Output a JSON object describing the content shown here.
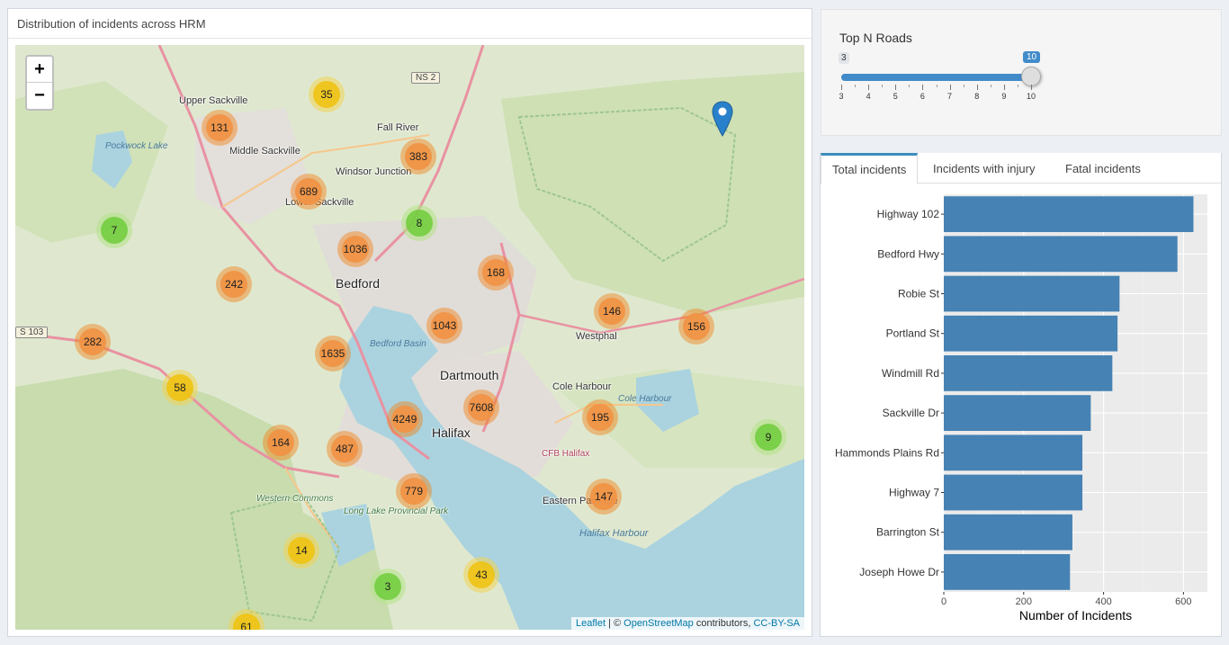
{
  "map_panel": {
    "title": "Distribution of incidents across HRM",
    "zoom_in": "+",
    "zoom_out": "−",
    "attribution": {
      "leaflet": "Leaflet",
      "sep": " | © ",
      "osm": "OpenStreetMap",
      "contrib": " contributors, ",
      "license": "CC-BY-SA"
    },
    "clusters": [
      {
        "label": "35",
        "size": "medium"
      },
      {
        "label": "131",
        "size": "large"
      },
      {
        "label": "383",
        "size": "large"
      },
      {
        "label": "689",
        "size": "large"
      },
      {
        "label": "8",
        "size": "small"
      },
      {
        "label": "7",
        "size": "small"
      },
      {
        "label": "1036",
        "size": "large"
      },
      {
        "label": "168",
        "size": "large"
      },
      {
        "label": "242",
        "size": "large"
      },
      {
        "label": "146",
        "size": "large"
      },
      {
        "label": "156",
        "size": "large"
      },
      {
        "label": "1043",
        "size": "large"
      },
      {
        "label": "282",
        "size": "large"
      },
      {
        "label": "1635",
        "size": "large"
      },
      {
        "label": "58",
        "size": "medium"
      },
      {
        "label": "7608",
        "size": "large"
      },
      {
        "label": "4249",
        "size": "large"
      },
      {
        "label": "195",
        "size": "large"
      },
      {
        "label": "9",
        "size": "small"
      },
      {
        "label": "164",
        "size": "large"
      },
      {
        "label": "487",
        "size": "large"
      },
      {
        "label": "779",
        "size": "large"
      },
      {
        "label": "147",
        "size": "large"
      },
      {
        "label": "14",
        "size": "medium"
      },
      {
        "label": "43",
        "size": "medium"
      },
      {
        "label": "3",
        "size": "small"
      },
      {
        "label": "61",
        "size": "medium"
      }
    ],
    "places": [
      "Upper Sackville",
      "Middle Sackville",
      "Fall River",
      "Windsor Junction",
      "Lower Sackville",
      "Bedford",
      "Dartmouth",
      "Halifax",
      "Westphal",
      "Cole Harbour",
      "CFB Halifax",
      "Eastern Passage"
    ],
    "water": [
      "Pockwock Lake",
      "Bedford Basin",
      "Cole Harbour",
      "Halifax Harbour"
    ],
    "parks": [
      "Western Commons",
      "Long Lake Provincial Park"
    ],
    "shields": [
      "NS 2",
      "S 103"
    ]
  },
  "slider": {
    "label": "Top N Roads",
    "min": 3,
    "max": 10,
    "value": 10,
    "min_label": "3",
    "value_label": "10",
    "tick_labels": [
      "3",
      "4",
      "5",
      "6",
      "7",
      "8",
      "9",
      "10"
    ]
  },
  "tabs": [
    {
      "label": "Total incidents",
      "active": true
    },
    {
      "label": "Incidents with injury",
      "active": false
    },
    {
      "label": "Fatal incidents",
      "active": false
    }
  ],
  "chart_data": {
    "type": "bar",
    "orientation": "horizontal",
    "categories": [
      "Highway 102",
      "Bedford Hwy",
      "Robie St",
      "Portland St",
      "Windmill Rd",
      "Sackville Dr",
      "Hammonds Plains Rd",
      "Highway 7",
      "Barrington St",
      "Joseph Howe Dr"
    ],
    "values": [
      625,
      585,
      440,
      435,
      422,
      368,
      347,
      347,
      322,
      316
    ],
    "xlabel": "Number of Incidents",
    "ylabel": "",
    "xlim": [
      0,
      660
    ],
    "x_ticks": [
      0,
      200,
      400,
      600
    ],
    "bar_color": "#4682b4",
    "panel_color": "#ebebeb",
    "grid": true
  }
}
